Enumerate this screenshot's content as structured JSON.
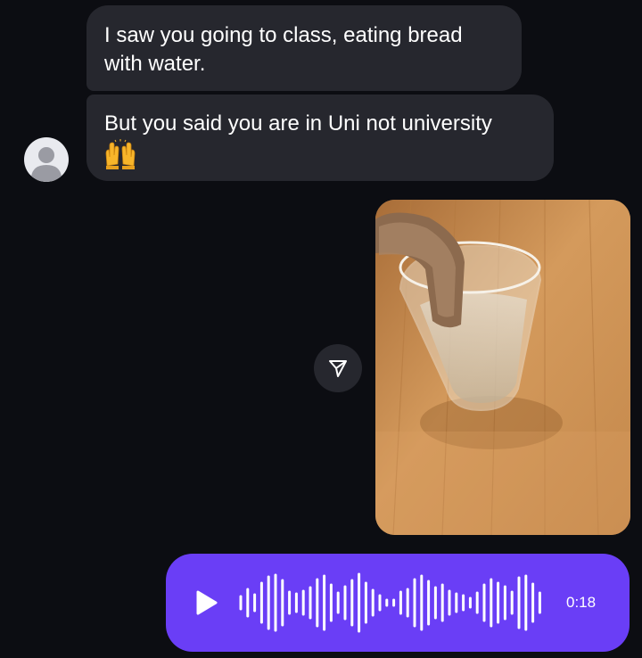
{
  "messages": [
    {
      "sender": "other",
      "text": "I saw you going to class, eating bread with water."
    },
    {
      "sender": "other",
      "text": "But you said you are in Uni not university"
    }
  ],
  "reaction_emoji": "raising-hands-emoji",
  "photo": {
    "description_icon": "bread-and-water-glass-photo"
  },
  "voice_message": {
    "duration": "0:18",
    "progress": 0,
    "color": "#6a3ef6"
  },
  "colors": {
    "background": "#0c0d12",
    "bubble": "#26272e",
    "accent": "#6a3ef6",
    "avatar": "#e9eaef"
  },
  "icons": {
    "avatar": "default-user-avatar-icon",
    "share": "paper-plane-share-icon",
    "play": "play-icon"
  }
}
